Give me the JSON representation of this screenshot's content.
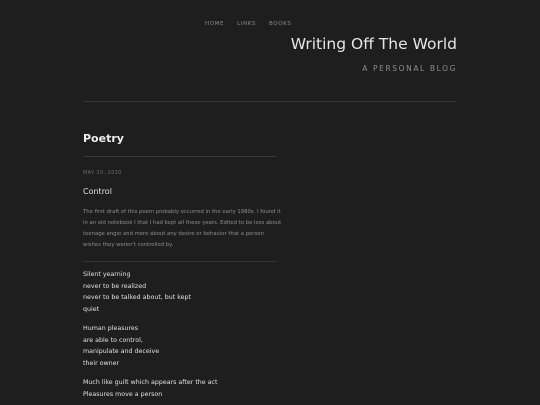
{
  "nav": {
    "home": "HOME",
    "links": "LINKS",
    "books": "BOOKS"
  },
  "site": {
    "title": "Writing Off The World",
    "subtitle": "A PERSONAL BLOG"
  },
  "category": {
    "title": "Poetry"
  },
  "post": {
    "date": "MAY 20, 2020",
    "title": "Control",
    "excerpt": "The first draft of this poem probably occurred in the early 1980s. I found it in an old notebook I that I had kept all these years. Edited to be less about teenage angst and more about any desire or behavior that a person wishes they weren't controlled by.",
    "stanzas": [
      [
        "Silent yearning",
        "never to be realized",
        "never to be talked about, but kept",
        "quiet"
      ],
      [
        "Human pleasures",
        "are able to control,",
        "manipulate and deceive",
        "their owner"
      ],
      [
        "Much like guilt which appears after the act",
        "Pleasures move a person"
      ]
    ]
  },
  "colors": {
    "background": "#1e1e1e",
    "text": "#e0e0e0",
    "muted": "#8d8d8d",
    "rule": "#393939"
  }
}
